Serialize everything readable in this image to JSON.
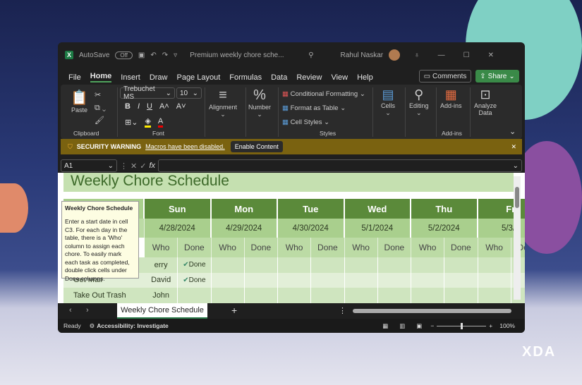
{
  "titlebar": {
    "autosave_label": "AutoSave",
    "autosave_state": "Off",
    "doc_title": "Premium weekly chore sche...",
    "user_name": "Rahul Naskar"
  },
  "menu": {
    "tabs": [
      "File",
      "Home",
      "Insert",
      "Draw",
      "Page Layout",
      "Formulas",
      "Data",
      "Review",
      "View",
      "Help"
    ],
    "comments": "Comments",
    "share": "Share"
  },
  "ribbon": {
    "paste": "Paste",
    "clipboard": "Clipboard",
    "font_name": "Trebuchet MS",
    "font_size": "10",
    "font": "Font",
    "alignment": "Alignment",
    "number": "Number",
    "cond_format": "Conditional Formatting",
    "format_table": "Format as Table",
    "cell_styles": "Cell Styles",
    "styles": "Styles",
    "cells": "Cells",
    "editing": "Editing",
    "addins": "Add-ins",
    "addins_group": "Add-ins",
    "analyze": "Analyze Data"
  },
  "security": {
    "title": "SECURITY WARNING",
    "message": "Macros have been disabled.",
    "button": "Enable Content"
  },
  "formula": {
    "name_box": "A1",
    "fx": "fx",
    "value": ""
  },
  "sheet": {
    "title": "Weekly Chore Schedule",
    "days": [
      {
        "day": "Sun",
        "date": "4/28/2024"
      },
      {
        "day": "Mon",
        "date": "4/29/2024"
      },
      {
        "day": "Tue",
        "date": "4/30/2024"
      },
      {
        "day": "Wed",
        "date": "5/1/2024"
      },
      {
        "day": "Thu",
        "date": "5/2/2024"
      },
      {
        "day": "Fr",
        "date": "5/3/2"
      }
    ],
    "who": "Who",
    "done": "Done",
    "rows": [
      {
        "chore": "",
        "who": "erry",
        "done": "Done"
      },
      {
        "chore": "Get Mail",
        "who": "David",
        "done": "Done"
      },
      {
        "chore": "Take Out Trash",
        "who": "John",
        "done": ""
      }
    ]
  },
  "tooltip": {
    "title": "Weekly Chore Schedule",
    "body": "Enter a start date in cell C3. For each day in the table, there is a 'Who' column to assign each chore. To easily mark each task as completed, double click cells under Done columns."
  },
  "sheet_tab": "Weekly Chore Schedule",
  "status": {
    "ready": "Ready",
    "accessibility": "Accessibility: Investigate",
    "zoom": "100%"
  },
  "watermark": "XDA"
}
